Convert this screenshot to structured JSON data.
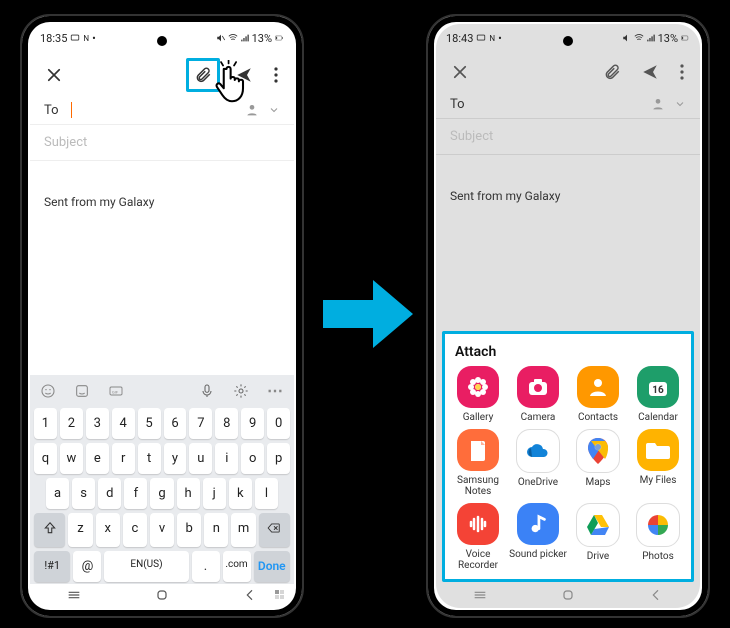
{
  "status": {
    "time_left": "18:35",
    "time_right": "18:43",
    "battery": "13%"
  },
  "compose": {
    "to_label": "To",
    "subject_placeholder": "Subject",
    "body_text": "Sent from my Galaxy"
  },
  "keyboard": {
    "lang": "EN(US)",
    "numrow": [
      "1",
      "2",
      "3",
      "4",
      "5",
      "6",
      "7",
      "8",
      "9",
      "0"
    ],
    "row1": [
      "q",
      "w",
      "e",
      "r",
      "t",
      "y",
      "u",
      "i",
      "o",
      "p"
    ],
    "row2": [
      "a",
      "s",
      "d",
      "f",
      "g",
      "h",
      "j",
      "k",
      "l"
    ],
    "row3_mid": [
      "z",
      "x",
      "c",
      "v",
      "b",
      "n",
      "m"
    ],
    "sym_key": "!#1",
    "at_key": "@",
    "period_key": ".",
    "com_key": ".com",
    "done_key": "Done"
  },
  "attach": {
    "title": "Attach",
    "apps": [
      {
        "label": "Gallery",
        "color": "#e91e63",
        "fg": "#fff",
        "icon": "flower"
      },
      {
        "label": "Camera",
        "color": "#e91e63",
        "fg": "#fff",
        "icon": "camera"
      },
      {
        "label": "Contacts",
        "color": "#ff9800",
        "fg": "#fff",
        "icon": "person"
      },
      {
        "label": "Calendar",
        "color": "#1e9e6a",
        "fg": "#fff",
        "icon": "cal",
        "text": "16"
      },
      {
        "label": "Samsung Notes",
        "color": "#ff6d3b",
        "fg": "#fff",
        "icon": "note"
      },
      {
        "label": "OneDrive",
        "color": "#fff",
        "fg": "#1283d8",
        "icon": "cloud",
        "border": "#ddd"
      },
      {
        "label": "Maps",
        "color": "#fff",
        "fg": "#34a853",
        "icon": "pin",
        "border": "#ddd"
      },
      {
        "label": "My Files",
        "color": "#ffb300",
        "fg": "#fff",
        "icon": "folder"
      },
      {
        "label": "Voice Recorder",
        "color": "#f44336",
        "fg": "#fff",
        "icon": "voice"
      },
      {
        "label": "Sound picker",
        "color": "#3b82f6",
        "fg": "#fff",
        "icon": "music"
      },
      {
        "label": "Drive",
        "color": "#fff",
        "fg": "#666",
        "icon": "drive",
        "border": "#ddd"
      },
      {
        "label": "Photos",
        "color": "#fff",
        "fg": "#666",
        "icon": "photos",
        "border": "#ddd"
      }
    ]
  }
}
